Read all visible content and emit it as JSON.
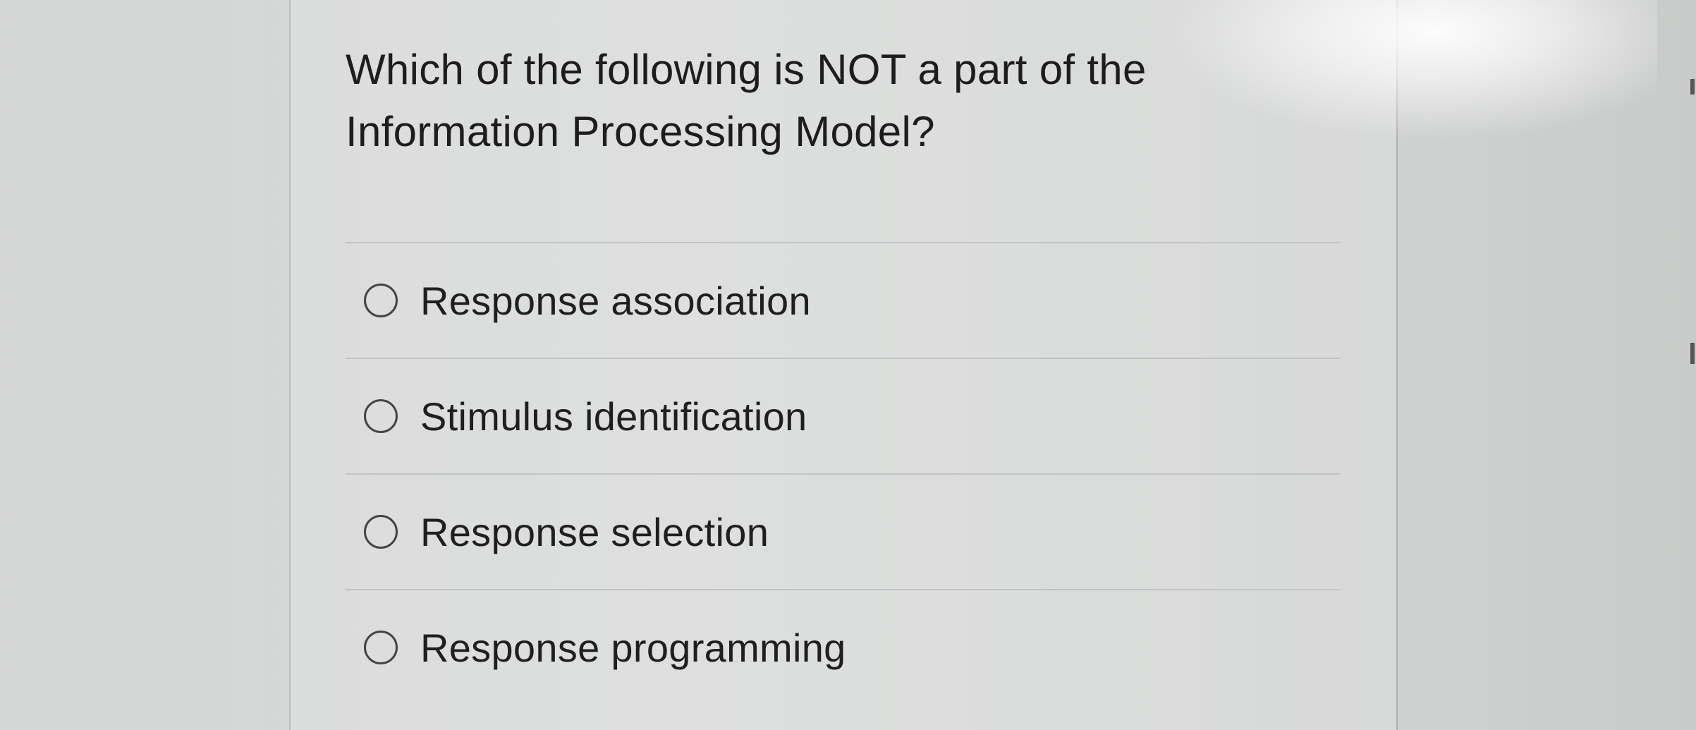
{
  "question": {
    "text": "Which of the following is NOT a part of the Information Processing Model?"
  },
  "options": [
    {
      "label": "Response association",
      "selected": false
    },
    {
      "label": "Stimulus identification",
      "selected": false
    },
    {
      "label": "Response selection",
      "selected": false
    },
    {
      "label": "Response programming",
      "selected": false
    }
  ]
}
